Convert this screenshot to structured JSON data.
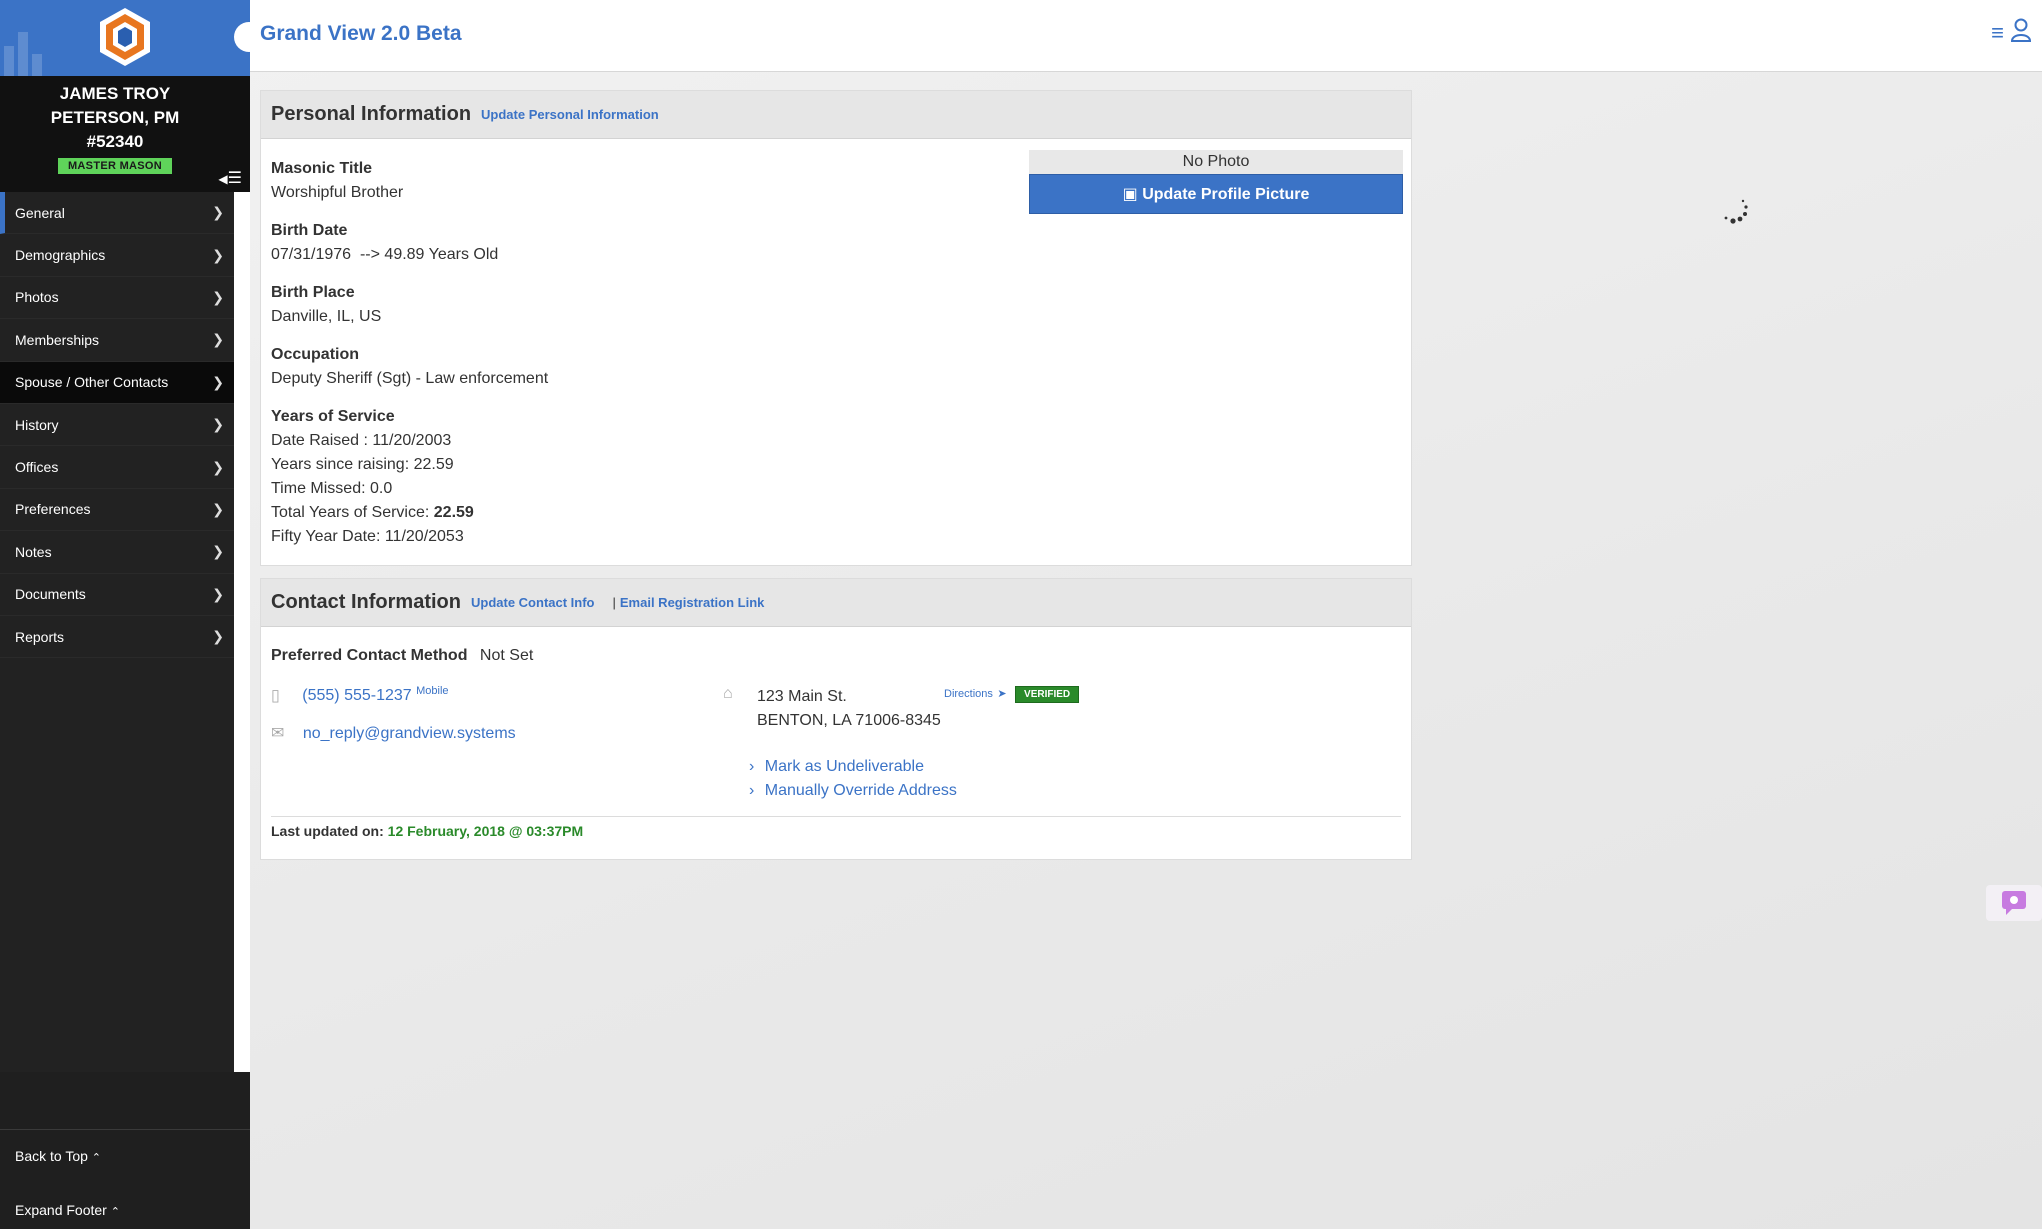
{
  "app": {
    "title": "Grand View 2.0 Beta",
    "brand_color": "#3b73c6"
  },
  "member": {
    "name": "JAMES TROY PETERSON, PM",
    "number": "#52340",
    "rank": "MASTER MASON"
  },
  "sidebar": {
    "items": [
      {
        "label": "General"
      },
      {
        "label": "Demographics"
      },
      {
        "label": "Photos"
      },
      {
        "label": "Memberships"
      },
      {
        "label": "Spouse / Other Contacts"
      },
      {
        "label": "History"
      },
      {
        "label": "Offices"
      },
      {
        "label": "Preferences"
      },
      {
        "label": "Notes"
      },
      {
        "label": "Documents"
      },
      {
        "label": "Reports"
      }
    ],
    "back_to_top": "Back to Top",
    "expand_footer": "Expand Footer"
  },
  "personal": {
    "heading": "Personal Information",
    "update_link": "Update Personal Information",
    "masonic_title_label": "Masonic Title",
    "masonic_title": "Worshipful Brother",
    "birth_date_label": "Birth Date",
    "birth_date": "07/31/1976  --> 49.89 Years Old",
    "birth_place_label": "Birth Place",
    "birth_place": "Danville, IL, US",
    "occupation_label": "Occupation",
    "occupation": "Deputy Sheriff (Sgt) - Law enforcement",
    "service_label": "Years of Service",
    "date_raised": "Date Raised : 11/20/2003",
    "years_since_raising": "Years since raising: 22.59",
    "time_missed": "Time Missed: 0.0",
    "total_service_prefix": "Total Years of Service: ",
    "total_service_value": "22.59",
    "fifty_year_date": "Fifty Year Date: 11/20/2053",
    "no_photo": "No Photo",
    "update_picture": "Update Profile Picture"
  },
  "contact": {
    "heading": "Contact Information",
    "update_link": "Update Contact Info",
    "separator": "|",
    "email_reg_link": "Email Registration Link",
    "preferred_label": "Preferred Contact Method",
    "preferred_value": "Not Set",
    "phone": "(555) 555-1237",
    "phone_type": "Mobile",
    "email": "no_reply@grandview.systems",
    "address_line1": "123 Main St.",
    "address_line2": "BENTON, LA 71006-8345",
    "directions": "Directions",
    "verified": "VERIFIED",
    "mark_undeliverable": "Mark as Undeliverable",
    "override_address": "Manually Override Address",
    "last_updated_label": "Last updated on:",
    "last_updated_value": "12 February, 2018 @ 03:37PM"
  }
}
